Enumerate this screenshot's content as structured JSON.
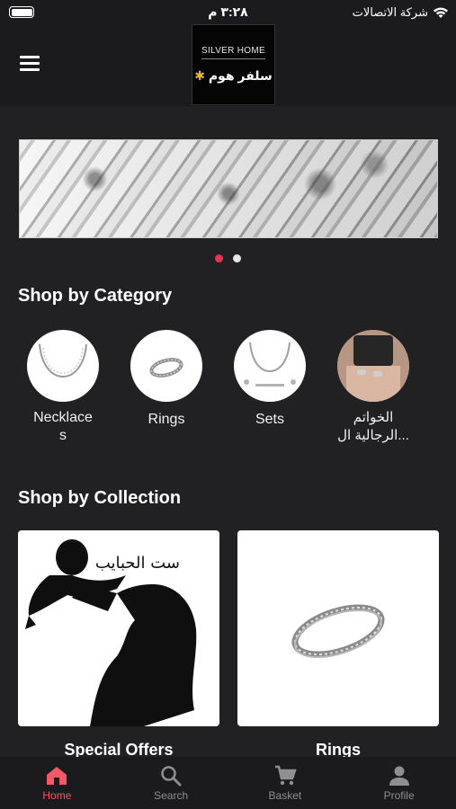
{
  "status_bar": {
    "time": "٣:٢٨ م",
    "carrier": "شركة الاتصالات"
  },
  "header": {
    "logo_en": "SILVER HOME",
    "logo_ar": "سلفر هوم"
  },
  "banner": {
    "slide_count": 2,
    "active_slide": 1
  },
  "categories": {
    "title": "Shop by Category",
    "items": [
      {
        "label": "Necklace s",
        "label_line1": "Necklace",
        "label_line2": "s"
      },
      {
        "label": "Rings",
        "label_line1": "Rings",
        "label_line2": ""
      },
      {
        "label": "Sets",
        "label_line1": "Sets",
        "label_line2": ""
      },
      {
        "label": "الخواتم الرجالية ال...",
        "label_line1": "الخواتم",
        "label_line2": "الرجالية ال..."
      }
    ]
  },
  "collections": {
    "title": "Shop by Collection",
    "items": [
      {
        "label": "Special Offers",
        "image_caption": "ست الحبايب"
      },
      {
        "label": "Rings"
      }
    ]
  },
  "tabbar": {
    "items": [
      {
        "label": "Home",
        "icon": "home-icon",
        "active": true
      },
      {
        "label": "Search",
        "icon": "search-icon",
        "active": false
      },
      {
        "label": "Basket",
        "icon": "cart-icon",
        "active": false
      },
      {
        "label": "Profile",
        "icon": "person-icon",
        "active": false
      }
    ]
  },
  "colors": {
    "background": "#212124",
    "accent": "#f05a67",
    "dot_active": "#e8344e"
  }
}
